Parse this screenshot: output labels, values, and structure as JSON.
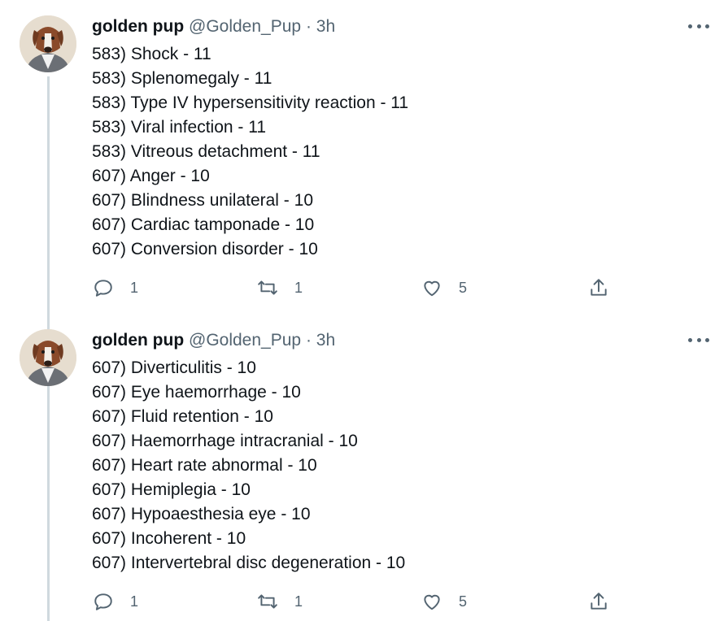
{
  "tweets": [
    {
      "name": "golden pup",
      "handle": "@Golden_Pup",
      "separator": "·",
      "time": "3h",
      "lines": [
        "583) Shock - 11",
        "583) Splenomegaly - 11",
        "583) Type IV hypersensitivity reaction - 11",
        "583) Viral infection - 11",
        "583) Vitreous detachment - 11",
        "607) Anger - 10",
        "607) Blindness unilateral - 10",
        "607) Cardiac tamponade - 10",
        "607) Conversion disorder - 10"
      ],
      "replies": "1",
      "retweets": "1",
      "likes": "5"
    },
    {
      "name": "golden pup",
      "handle": "@Golden_Pup",
      "separator": "·",
      "time": "3h",
      "lines": [
        "607) Diverticulitis - 10",
        "607) Eye haemorrhage - 10",
        "607) Fluid retention - 10",
        "607) Haemorrhage intracranial - 10",
        "607) Heart rate abnormal - 10",
        "607) Hemiplegia - 10",
        "607) Hypoaesthesia eye - 10",
        "607) Incoherent - 10",
        "607) Intervertebral disc degeneration - 10"
      ],
      "replies": "1",
      "retweets": "1",
      "likes": "5"
    }
  ],
  "icons": {
    "reply": "reply-icon",
    "retweet": "retweet-icon",
    "like": "heart-icon",
    "share": "share-icon",
    "more": "more-icon"
  },
  "colors": {
    "text": "#0f1419",
    "secondary": "#536471",
    "thread_line": "#cfd9de"
  }
}
